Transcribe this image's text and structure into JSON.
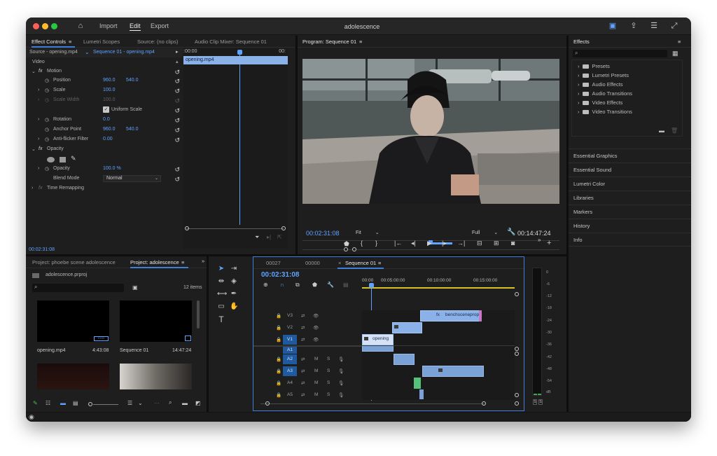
{
  "titlebar": {
    "home_icon": "home-icon",
    "nav": [
      "Import",
      "Edit",
      "Export"
    ],
    "active_nav": "Edit",
    "title": "adolescence"
  },
  "effect_controls": {
    "tabs": [
      "Effect Controls",
      "Lumetri Scopes",
      "Source: (no clips)",
      "Audio Clip Mixer: Sequence 01"
    ],
    "source_label": "Source - opening.mp4",
    "sequence_label": "Sequence 01 - opening.mp4",
    "ruler_start": ":00:00",
    "ruler_end": "00:",
    "clip_name": "opening.mp4",
    "section_video": "Video",
    "motion": "Motion",
    "position_label": "Position",
    "position_x": "960.0",
    "position_y": "540.0",
    "scale_label": "Scale",
    "scale_value": "100.0",
    "scale_width_label": "Scale Width",
    "scale_width_value": "100.0",
    "uniform_scale": "Uniform Scale",
    "rotation_label": "Rotation",
    "rotation_value": "0.0",
    "anchor_label": "Anchor Point",
    "anchor_x": "960.0",
    "anchor_y": "540.0",
    "antiflicker_label": "Anti-flicker Filter",
    "antiflicker_value": "0.00",
    "opacity_section": "Opacity",
    "opacity_label": "Opacity",
    "opacity_value": "100.0 %",
    "blend_label": "Blend Mode",
    "blend_value": "Normal",
    "time_remap": "Time Remapping",
    "timecode": "00:02:31:08"
  },
  "program": {
    "tab": "Program: Sequence 01",
    "timecode": "00:02:31:08",
    "fit": "Fit",
    "quality": "Full",
    "duration": "00:14:47:24"
  },
  "effects_panel": {
    "title": "Effects",
    "folders": [
      "Presets",
      "Lumetri Presets",
      "Audio Effects",
      "Audio Transitions",
      "Video Effects",
      "Video Transitions"
    ],
    "sections": [
      "Essential Graphics",
      "Essential Sound",
      "Lumetri Color",
      "Libraries",
      "Markers",
      "History",
      "Info"
    ]
  },
  "project": {
    "tabs": [
      "Project: phoebe scene adolescence",
      "Project: adolescence"
    ],
    "file": "adolescence.prproj",
    "count": "12 items",
    "items": [
      {
        "name": "opening.mp4",
        "duration": "4:43:08"
      },
      {
        "name": "Sequence 01",
        "duration": "14:47:24"
      }
    ]
  },
  "timeline": {
    "tabs": [
      "00027",
      "00000",
      "Sequence 01"
    ],
    "timecode": "00:02:31:08",
    "ruler": [
      "00:00",
      "00:05:00:00",
      "00:10:00:00",
      "00:15:00:00"
    ],
    "video_tracks": [
      "V3",
      "V2",
      "V1"
    ],
    "audio_tracks": [
      "A1",
      "A2",
      "A3",
      "A4",
      "A5"
    ],
    "clips": {
      "v1": "opening",
      "v3": "benchsceneproper"
    },
    "mute": "M",
    "solo": "S"
  },
  "meter": {
    "labels": [
      "0",
      "-6",
      "-12",
      "-18",
      "-24",
      "-30",
      "-36",
      "-42",
      "-48",
      "-54",
      "dB"
    ],
    "solo": [
      "S",
      "S"
    ]
  }
}
